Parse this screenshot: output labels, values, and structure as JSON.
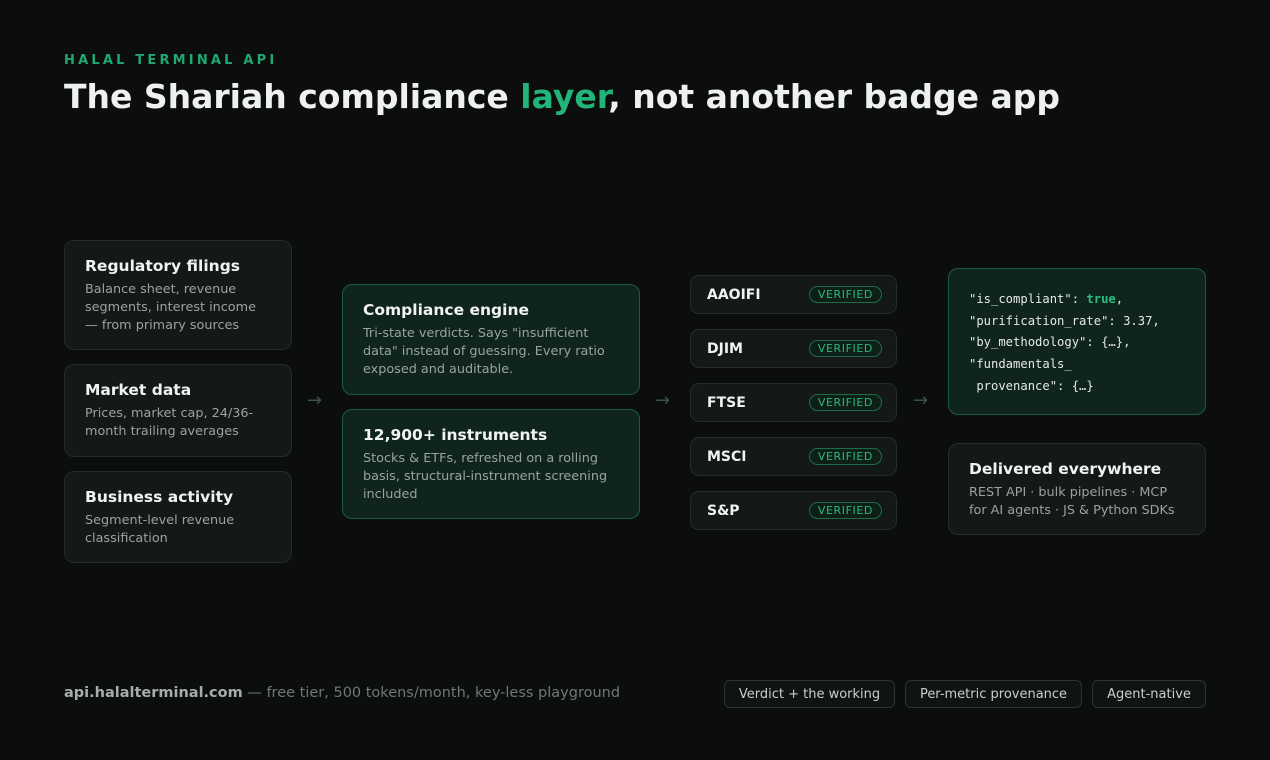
{
  "header": {
    "eyebrow": "HALAL TERMINAL API",
    "title_pre": "The Shariah compliance ",
    "title_accent": "layer",
    "title_post": ", not another badge app"
  },
  "sources": [
    {
      "title": "Regulatory filings",
      "desc": "Balance sheet, revenue segments, interest income — from primary sources"
    },
    {
      "title": "Market data",
      "desc": "Prices, market cap, 24/36-month trailing averages"
    },
    {
      "title": "Business activity",
      "desc": "Segment-level revenue classification"
    }
  ],
  "engine": [
    {
      "title": "Compliance engine",
      "desc": "Tri-state verdicts. Says \"insufficient data\" instead of guessing. Every ratio exposed and auditable."
    },
    {
      "title": "12,900+ instruments",
      "desc": "Stocks & ETFs, refreshed on a rolling basis, structural-instrument screening included"
    }
  ],
  "methodologies": [
    {
      "name": "AAOIFI",
      "badge": "VERIFIED"
    },
    {
      "name": "DJIM",
      "badge": "VERIFIED"
    },
    {
      "name": "FTSE",
      "badge": "VERIFIED"
    },
    {
      "name": "MSCI",
      "badge": "VERIFIED"
    },
    {
      "name": "S&P",
      "badge": "VERIFIED"
    }
  ],
  "arrow_glyph": "→",
  "code": {
    "l1_key": "\"is_compliant\": ",
    "l1_val": "true",
    "l1_end": ",",
    "l2": "\"purification_rate\": 3.37,",
    "l3": "\"by_methodology\": {…},",
    "l4": "\"fundamentals_",
    "l5": " provenance\": {…}"
  },
  "delivery": {
    "title": "Delivered everywhere",
    "desc": "REST API · bulk pipelines · MCP for AI agents · JS & Python SDKs"
  },
  "footer": {
    "domain": "api.halalterminal.com",
    "tagline": " — free tier, 500 tokens/month, key-less playground",
    "pills": [
      "Verdict + the working",
      "Per-metric provenance",
      "Agent-native"
    ]
  },
  "colors": {
    "accent": "#22b57a",
    "background": "#0b0e0d",
    "card": "#141917",
    "card_green": "#0f241c"
  }
}
